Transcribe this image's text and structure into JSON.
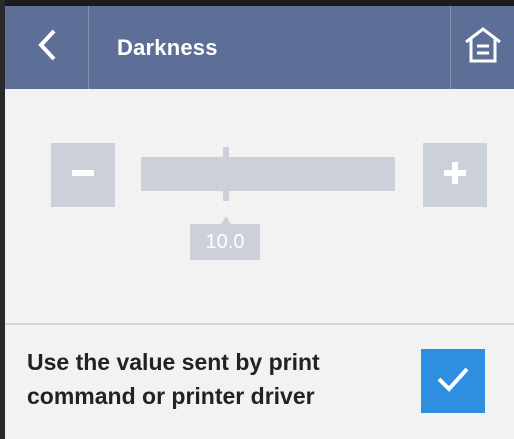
{
  "header": {
    "title": "Darkness",
    "back_icon": "chevron-left-icon",
    "home_icon": "home-icon",
    "background": "#5d6f97"
  },
  "slider": {
    "value_label": "10.0",
    "level": 0.33,
    "color": "#ccd1d9"
  },
  "option": {
    "label_line1": "Use the value sent by print",
    "label_line2": "command or printer driver",
    "checked": true,
    "checkbox_color": "#2e8fe0"
  }
}
